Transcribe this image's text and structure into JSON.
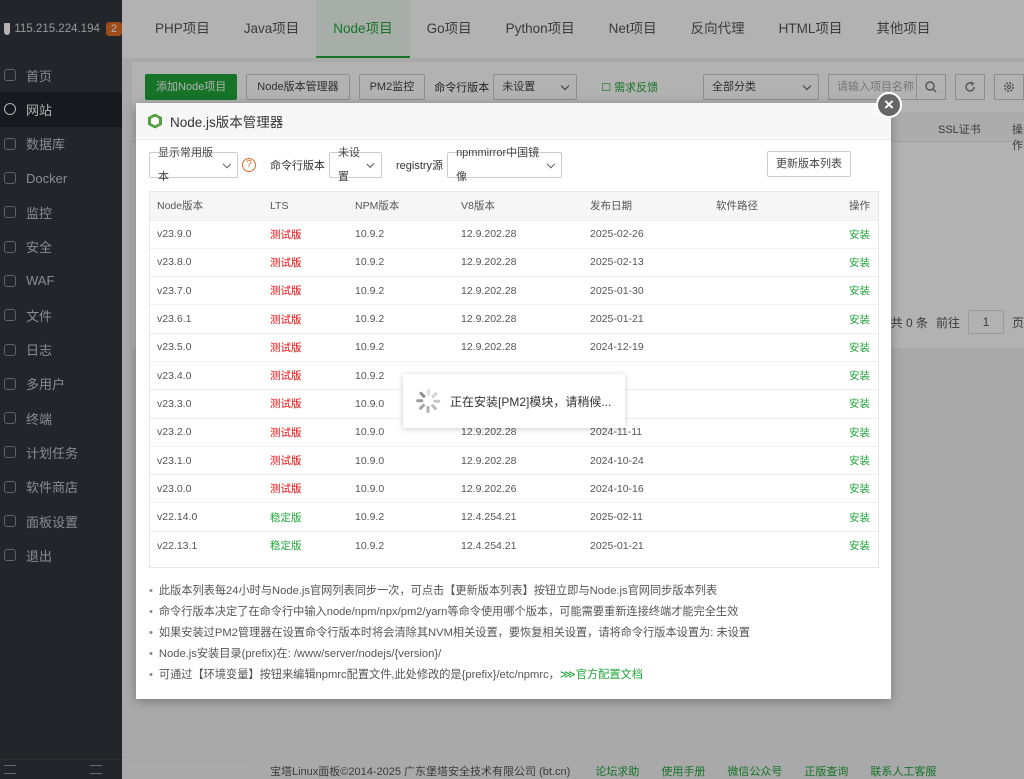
{
  "sidebar": {
    "ip": "115.215.224.194",
    "badge": "2",
    "items": [
      {
        "label": "首页",
        "icon": "home-icon"
      },
      {
        "label": "网站",
        "icon": "globe-icon",
        "active": true
      },
      {
        "label": "数据库",
        "icon": "database-icon"
      },
      {
        "label": "Docker",
        "icon": "docker-icon"
      },
      {
        "label": "监控",
        "icon": "monitor-icon"
      },
      {
        "label": "安全",
        "icon": "shield-icon"
      },
      {
        "label": "WAF",
        "icon": "waf-icon"
      },
      {
        "label": "文件",
        "icon": "folder-icon"
      },
      {
        "label": "日志",
        "icon": "log-icon"
      },
      {
        "label": "多用户",
        "icon": "users-icon"
      },
      {
        "label": "终端",
        "icon": "terminal-icon"
      },
      {
        "label": "计划任务",
        "icon": "clock-icon"
      },
      {
        "label": "软件商店",
        "icon": "store-icon"
      },
      {
        "label": "面板设置",
        "icon": "gear-icon"
      },
      {
        "label": "退出",
        "icon": "logout-icon"
      }
    ]
  },
  "tabs": [
    "PHP项目",
    "Java项目",
    "Node项目",
    "Go项目",
    "Python项目",
    "Net项目",
    "反向代理",
    "HTML项目",
    "其他项目"
  ],
  "toolbar": {
    "add_node": "添加Node项目",
    "version_manager": "Node版本管理器",
    "pm2": "PM2监控",
    "cli_label": "命令行版本",
    "cli_value": "未设置",
    "feedback": "需求反馈",
    "category": "全部分类",
    "search_placeholder": "请输入项目名称"
  },
  "table_bg": {
    "ssl": "SSL证书",
    "op": "操作"
  },
  "pager": {
    "total": "共 0 条",
    "goto": "前往",
    "page": "1",
    "unit": "页"
  },
  "footer": {
    "copyright": "宝塔Linux面板©2014-2025 广东堡塔安全技术有限公司 (bt.cn)",
    "links": [
      "论坛求助",
      "使用手册",
      "微信公众号",
      "正版查询",
      "联系人工客服"
    ]
  },
  "dialog": {
    "title": "Node.js版本管理器",
    "close": "×",
    "filter": "显示常用版本",
    "help": "?",
    "cli_label": "命令行版本",
    "cli_value": "未设置",
    "registry_label": "registry源",
    "registry_value": "npmmirror中国镜像",
    "update_btn": "更新版本列表",
    "columns": [
      "Node版本",
      "LTS",
      "NPM版本",
      "V8版本",
      "发布日期",
      "软件路径",
      "操作"
    ],
    "rows": [
      {
        "node": "v23.9.0",
        "lts": "测试版",
        "stable": false,
        "npm": "10.9.2",
        "v8": "12.9.202.28",
        "date": "2025-02-26",
        "path": "",
        "op": "安装"
      },
      {
        "node": "v23.8.0",
        "lts": "测试版",
        "stable": false,
        "npm": "10.9.2",
        "v8": "12.9.202.28",
        "date": "2025-02-13",
        "path": "",
        "op": "安装"
      },
      {
        "node": "v23.7.0",
        "lts": "测试版",
        "stable": false,
        "npm": "10.9.2",
        "v8": "12.9.202.28",
        "date": "2025-01-30",
        "path": "",
        "op": "安装"
      },
      {
        "node": "v23.6.1",
        "lts": "测试版",
        "stable": false,
        "npm": "10.9.2",
        "v8": "12.9.202.28",
        "date": "2025-01-21",
        "path": "",
        "op": "安装"
      },
      {
        "node": "v23.5.0",
        "lts": "测试版",
        "stable": false,
        "npm": "10.9.2",
        "v8": "12.9.202.28",
        "date": "2024-12-19",
        "path": "",
        "op": "安装"
      },
      {
        "node": "v23.4.0",
        "lts": "测试版",
        "stable": false,
        "npm": "10.9.2",
        "v8": "",
        "date": "",
        "path": "",
        "op": "安装"
      },
      {
        "node": "v23.3.0",
        "lts": "测试版",
        "stable": false,
        "npm": "10.9.0",
        "v8": "",
        "date": "",
        "path": "",
        "op": "安装"
      },
      {
        "node": "v23.2.0",
        "lts": "测试版",
        "stable": false,
        "npm": "10.9.0",
        "v8": "12.9.202.28",
        "date": "2024-11-11",
        "path": "",
        "op": "安装"
      },
      {
        "node": "v23.1.0",
        "lts": "测试版",
        "stable": false,
        "npm": "10.9.0",
        "v8": "12.9.202.28",
        "date": "2024-10-24",
        "path": "",
        "op": "安装"
      },
      {
        "node": "v23.0.0",
        "lts": "测试版",
        "stable": false,
        "npm": "10.9.0",
        "v8": "12.9.202.26",
        "date": "2024-10-16",
        "path": "",
        "op": "安装"
      },
      {
        "node": "v22.14.0",
        "lts": "稳定版",
        "stable": true,
        "npm": "10.9.2",
        "v8": "12.4.254.21",
        "date": "2025-02-11",
        "path": "",
        "op": "安装"
      },
      {
        "node": "v22.13.1",
        "lts": "稳定版",
        "stable": true,
        "npm": "10.9.2",
        "v8": "12.4.254.21",
        "date": "2025-01-21",
        "path": "",
        "op": "安装"
      }
    ],
    "notes": [
      "此版本列表每24小时与Node.js官网列表同步一次，可点击【更新版本列表】按钮立即与Node.js官网同步版本列表",
      "命令行版本决定了在命令行中输入node/npm/npx/pm2/yarn等命令使用哪个版本，可能需要重新连接终端才能完全生效",
      "如果安装过PM2管理器在设置命令行版本时将会清除其NVM相关设置，要恢复相关设置，请将命令行版本设置为: 未设置",
      "Node.js安装目录(prefix)在: /www/server/nodejs/{version}/",
      "可通过【环境变量】按钮来编辑npmrc配置文件,此处修改的是{prefix}/etc/npmrc，"
    ],
    "notes_link": "⋙官方配置文档"
  },
  "loading": {
    "text": "正在安装[PM2]模块，请稍候..."
  }
}
